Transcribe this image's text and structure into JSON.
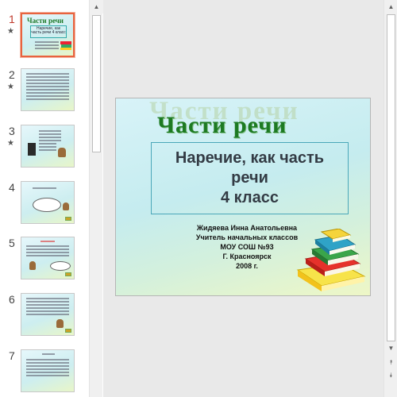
{
  "thumbnails": [
    {
      "number": "1",
      "star": "★",
      "title": "Части  речи",
      "box_text": "Наречие, как часть речи 4 класс"
    },
    {
      "number": "2",
      "star": "★"
    },
    {
      "number": "3",
      "star": "★"
    },
    {
      "number": "4"
    },
    {
      "number": "5"
    },
    {
      "number": "6"
    },
    {
      "number": "7"
    }
  ],
  "scrollbar": {
    "up_icon": "▲",
    "down_icon": "▼",
    "prev_slide_icon": "⯭",
    "next_slide_icon": "⯯"
  },
  "slide": {
    "ghost_title": "Части  речи",
    "title": "Части  речи",
    "subtitle_lines": [
      "Наречие, как часть",
      "речи",
      "4 класс"
    ],
    "author_lines": [
      "Жидяева Инна Анатольевна",
      "Учитель начальных классов",
      "МОУ  СОШ №93",
      "Г. Красноярск",
      "2008 г."
    ]
  },
  "colors": {
    "selected_border": "#e8633f",
    "title_green": "#1d7a22",
    "subtitle_text": "#333b44"
  }
}
